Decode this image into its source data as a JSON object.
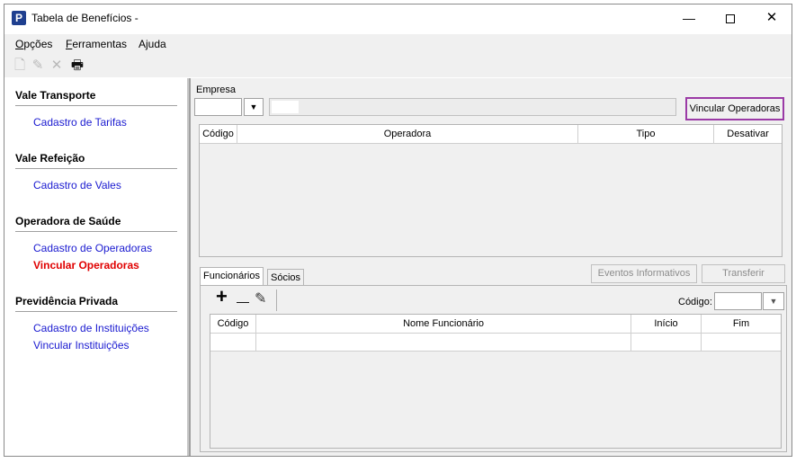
{
  "window": {
    "title": "Tabela de Benefícios -",
    "app_icon_letter": "P",
    "controls": {
      "minimize": "—",
      "close": "✕"
    }
  },
  "menu": {
    "items": [
      {
        "label": "Opções",
        "underline": "O",
        "rest": "pções"
      },
      {
        "label": "Ferramentas",
        "underline": "F",
        "rest": "erramentas"
      },
      {
        "label": "Ajuda",
        "underline": "",
        "rest": "Ajuda"
      }
    ]
  },
  "toolbar": {
    "icons": [
      "new-document-icon",
      "edit-pencil-icon",
      "delete-x-icon",
      "print-icon"
    ],
    "glyphs": {
      "new": "🗋",
      "edit": "✎",
      "delete": "✕",
      "print": "🖶"
    }
  },
  "sidebar": {
    "sections": [
      {
        "title": "Vale Transporte",
        "links": [
          "Cadastro de Tarifas"
        ]
      },
      {
        "title": "Vale Refeição",
        "links": [
          "Cadastro de Vales"
        ]
      },
      {
        "title": "Operadora de Saúde",
        "links": [
          "Cadastro de Operadoras",
          "Vincular Operadoras"
        ]
      },
      {
        "title": "Previdência Privada",
        "links": [
          "Cadastro de Instituições",
          "Vincular Instituições"
        ]
      }
    ],
    "active_link": "Vincular Operadoras"
  },
  "form": {
    "empresa_label": "Empresa",
    "empresa_code": "",
    "empresa_name": "",
    "dropdown_glyph": "▼",
    "vincular_button": "Vincular Operadoras"
  },
  "operadoras_grid": {
    "columns": [
      "Código",
      "Operadora",
      "Tipo",
      "Desativar"
    ],
    "rows": []
  },
  "tabs": {
    "items": [
      "Funcionários",
      "Sócios"
    ],
    "selected": "Funcionários"
  },
  "actions": {
    "eventos": "Eventos Informativos",
    "transferir": "Transferir"
  },
  "funcionarios_panel": {
    "toolbar_glyphs": {
      "add": "+",
      "remove": "—",
      "edit": "✎"
    },
    "codigo_label": "Código:",
    "codigo_value": "",
    "columns": [
      "Código",
      "Nome Funcionário",
      "Início",
      "Fim"
    ],
    "rows": [
      [
        "",
        "",
        "",
        ""
      ]
    ]
  },
  "colors": {
    "link": "#1a1ad0",
    "active_link": "#e00000",
    "highlight_border": "#9b3aa6",
    "app_icon": "#1f3f8f"
  }
}
